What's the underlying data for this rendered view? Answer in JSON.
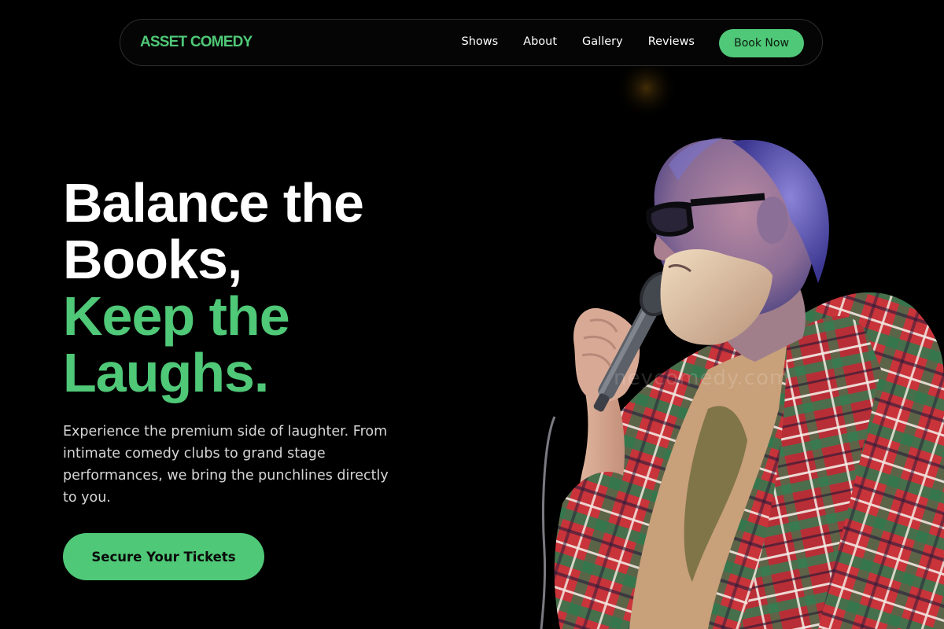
{
  "nav": {
    "logo": "ASSET COMEDY",
    "links": [
      "Shows",
      "About",
      "Gallery",
      "Reviews"
    ],
    "cta_label": "Book Now"
  },
  "hero": {
    "headline_line1": "Balance the",
    "headline_line2": "Books,",
    "headline_line3": "Keep the",
    "headline_line4": "Laughs.",
    "subtext": "Experience the premium side of laughter. From intimate comedy clubs to grand stage performances, we bring the punchlines directly to you.",
    "cta_label": "Secure Your Tickets",
    "watermark": "neycomedy.com"
  },
  "colors": {
    "accent": "#4fc877",
    "background": "#000000",
    "text_primary": "#ffffff",
    "text_secondary": "#d6d6d6"
  }
}
